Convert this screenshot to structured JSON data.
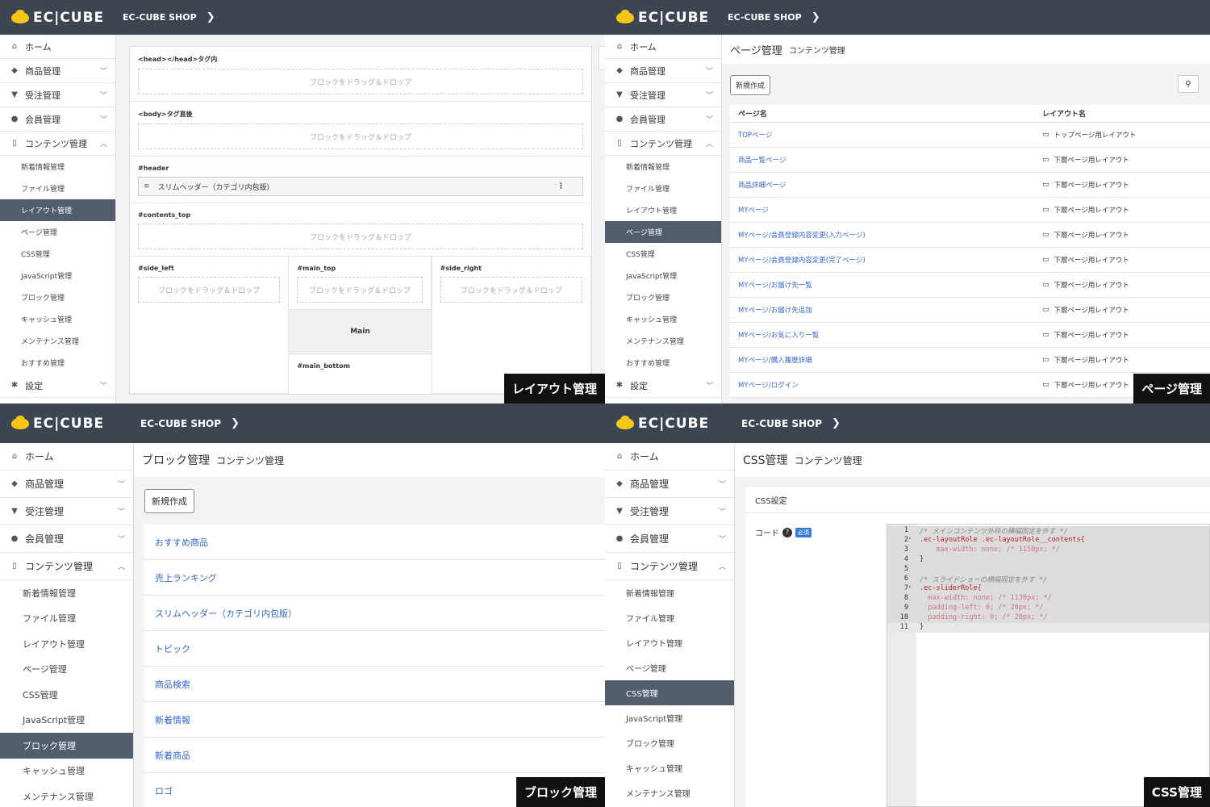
{
  "brand": {
    "logo": "EC|CUBE",
    "shop": "EC-CUBE SHOP"
  },
  "nav": {
    "home": "ホーム",
    "products": "商品管理",
    "orders": "受注管理",
    "customers": "会員管理",
    "contents": "コンテンツ管理",
    "settings": "設定"
  },
  "subnav": [
    "新着情報管理",
    "ファイル管理",
    "レイアウト管理",
    "ページ管理",
    "CSS管理",
    "JavaScript管理",
    "ブロック管理",
    "キャッシュ管理",
    "メンテナンス管理",
    "おすすめ管理"
  ],
  "labels": {
    "layout": "レイアウト管理",
    "page": "ページ管理",
    "block": "ブロック管理",
    "css": "CSS管理"
  },
  "layout": {
    "head": "<head></head>タグ内",
    "body": "<body>タグ直後",
    "header": "#header",
    "contents_top": "#contents_top",
    "side_left": "#side_left",
    "main_top": "#main_top",
    "side_right": "#side_right",
    "main": "Main",
    "main_bottom": "#main_bottom",
    "drop": "ブロックをドラッグ＆ドロップ",
    "header_block": "スリムヘッダー（カテゴリ内包版）"
  },
  "page": {
    "title": "ページ管理",
    "crumb": "コンテンツ管理",
    "new": "新規作成",
    "col1": "ページ名",
    "col2": "レイアウト名",
    "rows": [
      {
        "name": "TOPページ",
        "layout": "トップページ用レイアウト"
      },
      {
        "name": "商品一覧ページ",
        "layout": "下層ページ用レイアウト"
      },
      {
        "name": "商品詳細ページ",
        "layout": "下層ページ用レイアウト"
      },
      {
        "name": "MYページ",
        "layout": "下層ページ用レイアウト"
      },
      {
        "name": "MYページ/会員登録内容変更(入力ページ)",
        "layout": "下層ページ用レイアウト"
      },
      {
        "name": "MYページ/会員登録内容変更(完了ページ)",
        "layout": "下層ページ用レイアウト"
      },
      {
        "name": "MYページ/お届け先一覧",
        "layout": "下層ページ用レイアウト"
      },
      {
        "name": "MYページ/お届け先追加",
        "layout": "下層ページ用レイアウト"
      },
      {
        "name": "MYページ/お気に入り一覧",
        "layout": "下層ページ用レイアウト"
      },
      {
        "name": "MYページ/購入履歴詳細",
        "layout": "下層ページ用レイアウト"
      },
      {
        "name": "MYページ/ログイン",
        "layout": "下層ページ用レイアウト"
      }
    ]
  },
  "block": {
    "title": "ブロック管理",
    "crumb": "コンテンツ管理",
    "new": "新規作成",
    "items": [
      "おすすめ商品",
      "売上ランキング",
      "スリムヘッダー（カテゴリ内包版）",
      "トピック",
      "商品検索",
      "新着情報",
      "新着商品",
      "ロゴ"
    ]
  },
  "css": {
    "title": "CSS管理",
    "crumb": "コンテンツ管理",
    "section": "CSS設定",
    "code_label": "コード",
    "required": "必須",
    "lines": [
      "/* メインコンテンツ外枠の横幅固定を外す */",
      ".ec-layoutRole .ec-layoutRole__contents{",
      "    max-width: none; /* 1150px; */",
      "}",
      "",
      "/* スライドショーの横幅固定を外す */",
      ".ec-sliderRole{",
      "  max-width: none; /* 1130px; */",
      "  padding-left: 0; /* 20px; */",
      "  padding-right: 0; /* 20px; */",
      "}"
    ]
  }
}
